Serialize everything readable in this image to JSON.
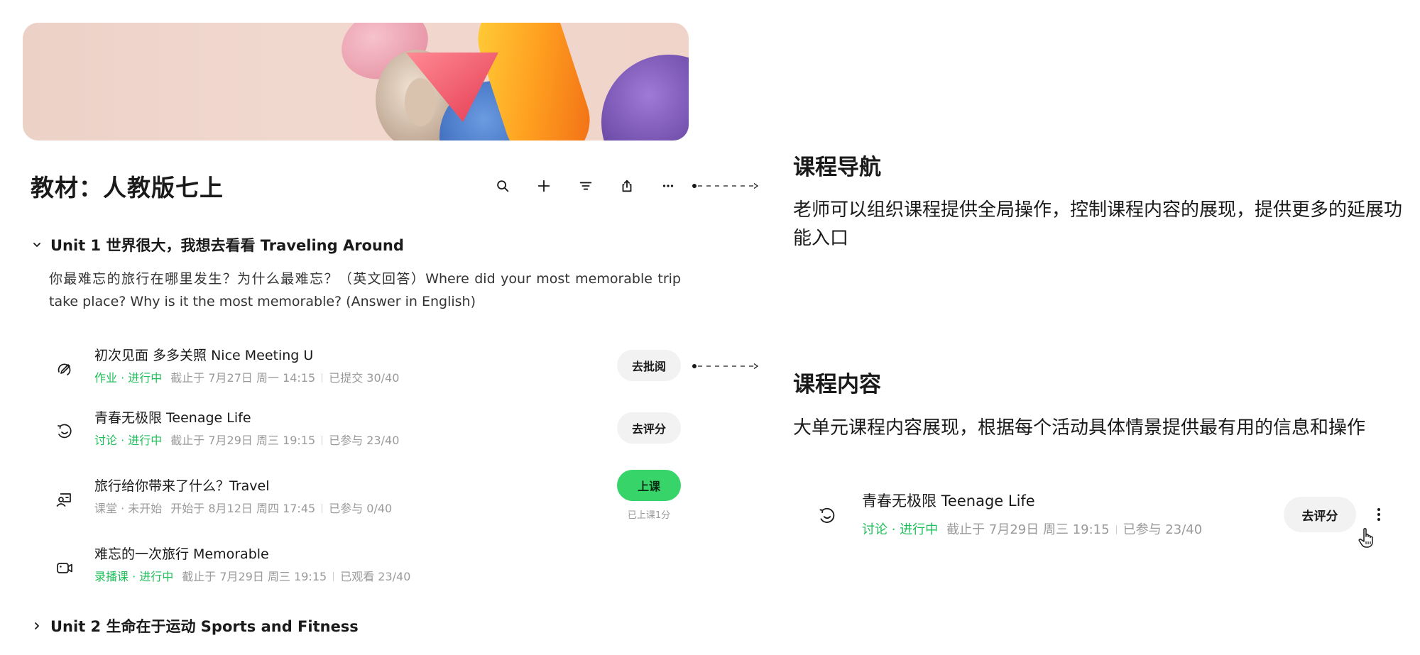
{
  "textbook": {
    "title": "教材：人教版七上"
  },
  "toolbar": {
    "icons": [
      "search-icon",
      "plus-icon",
      "filter-icon",
      "share-icon",
      "more-icon"
    ]
  },
  "units": [
    {
      "label": "Unit 1 世界很大，我想去看看 Traveling Around",
      "expanded": true,
      "description": "你最难忘的旅行在哪里发生？为什么最难忘？（英文回答）Where did your most memorable trip take place? Why is it the most memorable? (Answer in English)",
      "activities": [
        {
          "icon": "homework-icon",
          "name": "初次见面 多多关照 Nice Meeting U",
          "status": "作业 · 进行中",
          "time": "截止于 7月27日 周一 14:15",
          "count": "已提交 30/40",
          "button": "去批阅"
        },
        {
          "icon": "discussion-icon",
          "name": "青春无极限 Teenage Life",
          "status": "讨论 · 进行中",
          "time": "截止于 7月29日 周三 19:15",
          "count": "已参与 23/40",
          "button": "去评分"
        },
        {
          "icon": "classroom-icon",
          "name": "旅行给你带来了什么？Travel",
          "status": "课堂 · 未开始",
          "time": "开始于 8月12日 周四 17:45",
          "count": "已参与 0/40",
          "button": "上课",
          "button_sub": "已上课1分"
        },
        {
          "icon": "video-icon",
          "name": "难忘的一次旅行 Memorable",
          "status": "录播课 · 进行中",
          "time": "截止于 7月29日 周三 19:15",
          "count": "已观看 23/40"
        }
      ]
    },
    {
      "label": "Unit 2 生命在于运动 Sports and Fitness",
      "expanded": false
    }
  ],
  "annotations": {
    "nav": {
      "title": "课程导航",
      "description": "老师可以组织课程提供全局操作，控制课程内容的展现，提供更多的延展功能入口"
    },
    "content": {
      "title": "课程内容",
      "description": "大单元课程内容展现，根据每个活动具体情景提供最有用的信息和操作",
      "example": {
        "icon": "discussion-icon",
        "name": "青春无极限 Teenage Life",
        "status": "讨论 · 进行中",
        "time": "截止于 7月29日 周三 19:15",
        "count": "已参与 23/40",
        "button": "去评分"
      }
    }
  },
  "colors": {
    "accent_green": "#37d46a",
    "status_green": "#1fbf5a",
    "muted": "#9a9a9a",
    "button_bg": "#f2f2f2"
  }
}
